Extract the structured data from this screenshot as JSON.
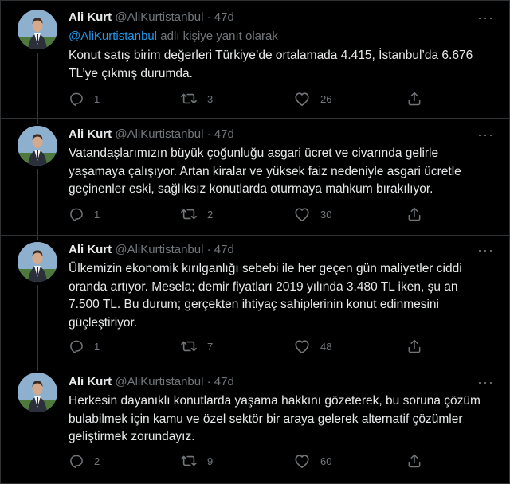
{
  "tweets": [
    {
      "name": "Ali Kurt",
      "handle": "@AliKurtistanbul",
      "dot": "·",
      "time": "47d",
      "reply_mention": "@AliKurtistanbul",
      "reply_suffix": " adlı kişiye yanıt olarak",
      "text": "Konut satış birim değerleri Türkiye’de ortalamada 4.415, İstanbul’da 6.676 TL’ye çıkmış durumda.",
      "replies": "1",
      "retweets": "3",
      "likes": "26"
    },
    {
      "name": "Ali Kurt",
      "handle": "@AliKurtistanbul",
      "dot": "·",
      "time": "47d",
      "text": "Vatandaşlarımızın büyük çoğunluğu asgari ücret ve civarında gelirle yaşamaya çalışıyor. Artan kiralar ve yüksek faiz nedeniyle asgari ücretle geçinenler eski, sağlıksız konutlarda oturmaya mahkum bırakılıyor.",
      "replies": "1",
      "retweets": "2",
      "likes": "30"
    },
    {
      "name": "Ali Kurt",
      "handle": "@AliKurtistanbul",
      "dot": "·",
      "time": "47d",
      "text": "Ülkemizin ekonomik kırılganlığı sebebi ile her geçen gün maliyetler ciddi oranda artıyor. Mesela; demir fiyatları 2019 yılında 3.480 TL  iken, şu an 7.500 TL. Bu durum; gerçekten ihtiyaç sahiplerinin konut edinmesini güçleştiriyor.",
      "replies": "1",
      "retweets": "7",
      "likes": "48"
    },
    {
      "name": "Ali Kurt",
      "handle": "@AliKurtistanbul",
      "dot": "·",
      "time": "47d",
      "text": "Herkesin dayanıklı konutlarda yaşama hakkını gözeterek, bu soruna çözüm bulabilmek için kamu ve özel sektör bir araya gelerek alternatif çözümler geliştirmek zorundayız.",
      "replies": "2",
      "retweets": "9",
      "likes": "60"
    }
  ],
  "colors": {
    "background": "#000000",
    "text": "#e7e9ea",
    "secondary": "#71767b",
    "link": "#1d9bf0",
    "border": "#2f3336"
  },
  "icons": [
    "reply-icon",
    "retweet-icon",
    "like-icon",
    "share-icon",
    "more-options-icon"
  ]
}
